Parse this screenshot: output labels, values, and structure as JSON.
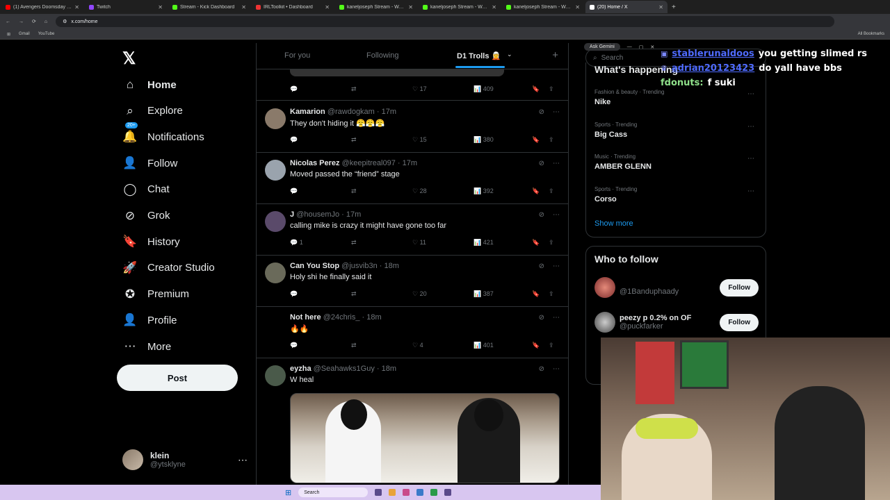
{
  "browser": {
    "tabs": [
      {
        "title": "(1) Avengers Doomsday | Offici",
        "color": "#ff0000"
      },
      {
        "title": "Twitch",
        "color": "#9146ff"
      },
      {
        "title": "Stream - Kick Dashboard",
        "color": "#53fc18"
      },
      {
        "title": "IRLToolkit • Dashboard",
        "color": "#e33"
      },
      {
        "title": "kaneljoseph Stream - Watch Liv",
        "color": "#53fc18"
      },
      {
        "title": "kaneljoseph Stream - Watch Liv",
        "color": "#53fc18"
      },
      {
        "title": "kaneljoseph Stream - Watch Liv",
        "color": "#53fc18"
      },
      {
        "title": "(20) Home / X",
        "color": "#ffffff"
      }
    ],
    "ask_gemini": "Ask Gemini",
    "url": "x.com/home",
    "bookmarks": [
      "Gmail",
      "YouTube"
    ],
    "all_bookmarks": "All Bookmarks"
  },
  "nav": {
    "logo": "𝕏",
    "items": [
      {
        "label": "Home",
        "icon": "⌂"
      },
      {
        "label": "Explore",
        "icon": "⌕"
      },
      {
        "label": "Notifications",
        "icon": "🔔",
        "badge": "20+"
      },
      {
        "label": "Follow",
        "icon": "👤"
      },
      {
        "label": "Chat",
        "icon": "◯"
      },
      {
        "label": "Grok",
        "icon": "⊘"
      },
      {
        "label": "History",
        "icon": "🔖"
      },
      {
        "label": "Creator Studio",
        "icon": "🚀"
      },
      {
        "label": "Premium",
        "icon": "✪"
      },
      {
        "label": "Profile",
        "icon": "👤"
      },
      {
        "label": "More",
        "icon": "⋯"
      }
    ],
    "post_label": "Post",
    "user": {
      "name": "klein",
      "handle": "@ytsklyne"
    }
  },
  "feed": {
    "tabs": [
      "For you",
      "Following",
      "D1 Trolls 🧝"
    ],
    "first_actions": {
      "likes": "17",
      "views": "409"
    },
    "posts": [
      {
        "name": "Kamarion",
        "handle": "@rawdogkam",
        "time": "· 17m",
        "text": "They don't hiding it 😤😤😤",
        "replies": "",
        "likes": "15",
        "views": "380",
        "avatar": "#8a7a6a"
      },
      {
        "name": "Nicolas Perez",
        "handle": "@keepitreal097",
        "time": "· 17m",
        "text": "Moved passed the “friend” stage",
        "replies": "",
        "likes": "28",
        "views": "392",
        "avatar": "#9aa3ad"
      },
      {
        "name": "J",
        "handle": "@housemJo",
        "time": "· 17m",
        "text": "calling mike is crazy it might have gone too far",
        "replies": "1",
        "likes": "11",
        "views": "421",
        "avatar": "#5a4a6a"
      },
      {
        "name": "Can You Stop",
        "handle": "@jusvib3n",
        "time": "· 18m",
        "text": "Holy shi he finally said it",
        "replies": "",
        "likes": "20",
        "views": "387",
        "avatar": "#6a6a5a"
      },
      {
        "name": "Not here",
        "handle": "@24chris_",
        "time": "· 18m",
        "text": "🔥🔥",
        "replies": "",
        "likes": "4",
        "views": "401",
        "avatar": "#000000"
      },
      {
        "name": "eyzha",
        "handle": "@Seahawks1Guy",
        "time": "· 18m",
        "text": "W heal",
        "replies": "",
        "likes": "",
        "views": "",
        "avatar": "#4a5a4a"
      }
    ]
  },
  "right": {
    "search_placeholder": "Search",
    "whats_happening": "What's happening",
    "trends": [
      {
        "cat": "Fashion & beauty · Trending",
        "topic": "Nike"
      },
      {
        "cat": "Sports · Trending",
        "topic": "Big Cass"
      },
      {
        "cat": "Music · Trending",
        "topic": "AMBER GLENN"
      },
      {
        "cat": "Sports · Trending",
        "topic": "Corso"
      }
    ],
    "show_more": "Show more",
    "who_to_follow": "Who to follow",
    "follows": [
      {
        "name": "",
        "handle": "@1Banduphaady",
        "button": "Follow"
      },
      {
        "name": "peezy p 0.2% on OF",
        "handle": "@puckfarker",
        "button": "Follow"
      }
    ]
  },
  "chat": [
    {
      "user": "stablerunaldoos",
      "msg": "you getting slimed rs"
    },
    {
      "user": "adrian20123423",
      "msg": "do yall have bbs"
    },
    {
      "user": "fdonuts:",
      "msg": "f suki"
    }
  ],
  "taskbar": {
    "search": "Search"
  }
}
